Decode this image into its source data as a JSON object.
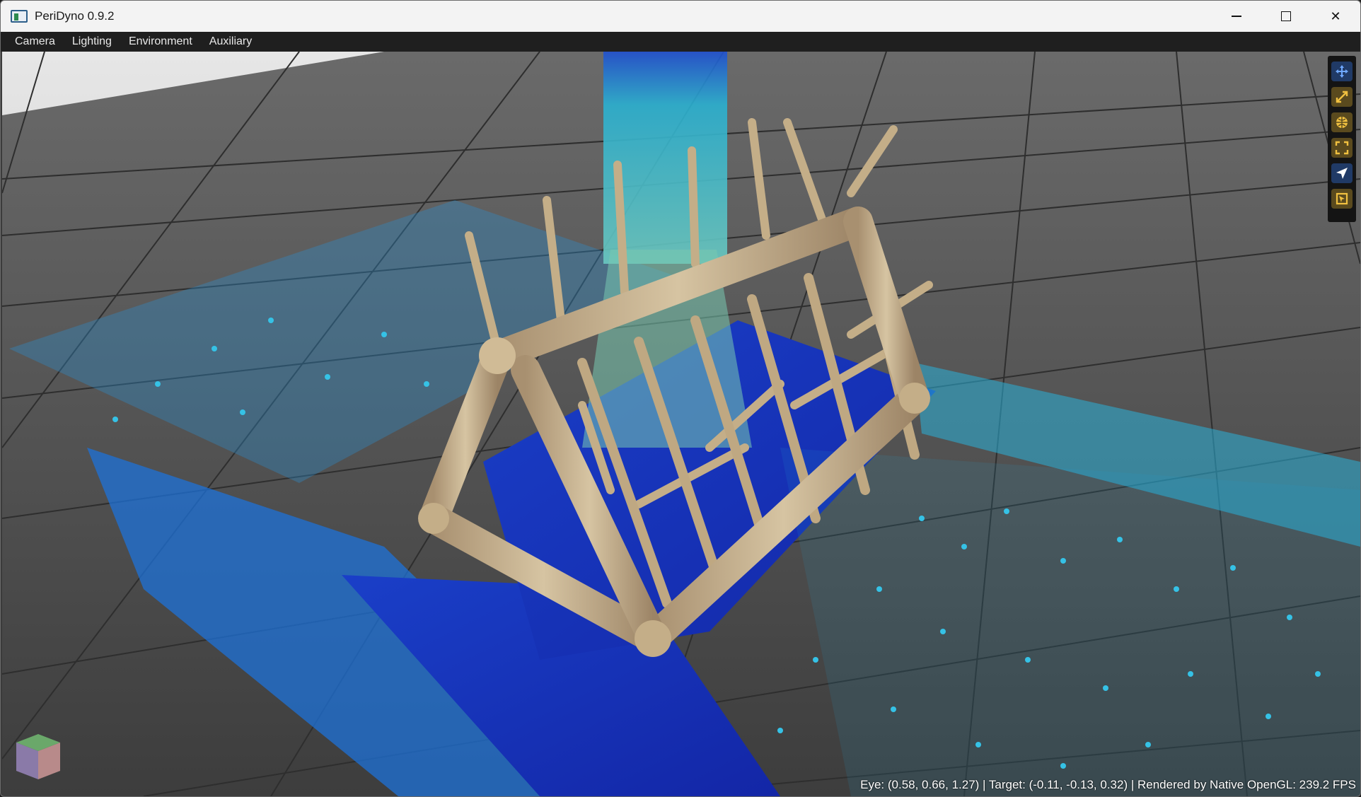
{
  "window": {
    "title": "PeriDyno 0.9.2",
    "controls": {
      "minimize": "minimize",
      "maximize": "maximize",
      "close": "✕"
    }
  },
  "menubar": {
    "items": [
      {
        "label": "Camera"
      },
      {
        "label": "Lighting"
      },
      {
        "label": "Environment"
      },
      {
        "label": "Auxiliary"
      }
    ]
  },
  "toolbar": {
    "tools": [
      {
        "icon": "move-icon",
        "color": "#3a7bd5"
      },
      {
        "icon": "scale-icon",
        "color": "#d4a93a"
      },
      {
        "icon": "globe-icon",
        "color": "#d4a93a"
      },
      {
        "icon": "fullscreen-icon",
        "color": "#d4a93a"
      },
      {
        "icon": "navigate-icon",
        "color": "#3a7bd5"
      },
      {
        "icon": "select-icon",
        "color": "#d4a93a"
      }
    ]
  },
  "status": {
    "text": "Eye: (0.58, 0.66, 1.27) | Target: (-0.11, -0.13, 0.32) | Rendered by Native OpenGL: 239.2 FPS"
  },
  "colors": {
    "floor": "#4a4a4a",
    "grid": "#2a2a2a",
    "frame": "#c8b490",
    "fluid_deep": "#1a2fb8",
    "fluid_light": "#2fb8d8"
  }
}
